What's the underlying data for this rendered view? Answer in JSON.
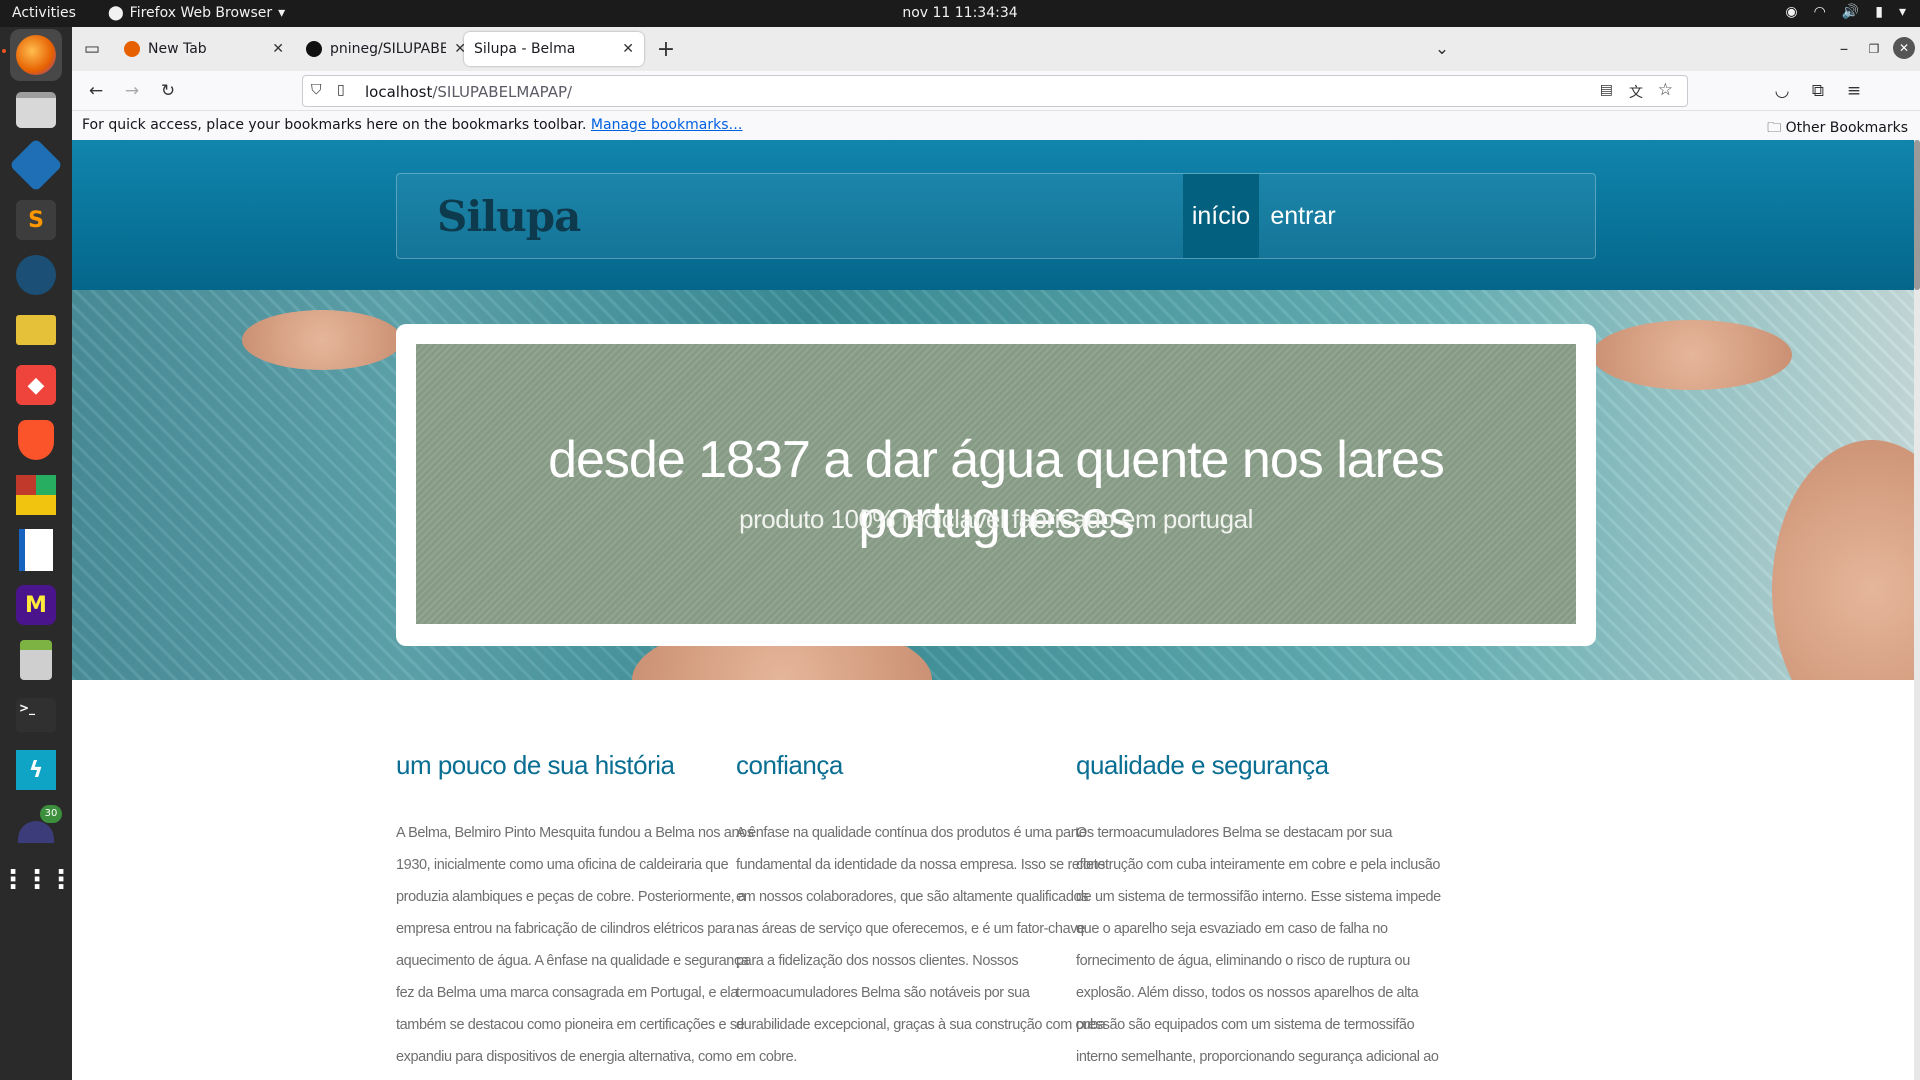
{
  "topbar": {
    "activities": "Activities",
    "app_name": "Firefox Web Browser",
    "clock": "nov 11  11:34:34"
  },
  "dock": {
    "items": [
      {
        "name": "firefox",
        "color": "#e66000"
      },
      {
        "name": "files",
        "color": "#b7b7b7"
      },
      {
        "name": "virtualbox",
        "color": "#1e6fb5"
      },
      {
        "name": "sublime-text",
        "color": "#ff9800"
      },
      {
        "name": "steam",
        "color": "#1b4f75"
      },
      {
        "name": "email-client",
        "color": "#2f3e2f"
      },
      {
        "name": "anydesk",
        "color": "#ef443b"
      },
      {
        "name": "brave",
        "color": "#fb542b"
      },
      {
        "name": "app-grid-colored",
        "color": "#c0392b"
      },
      {
        "name": "writer",
        "color": "#1565c0"
      },
      {
        "name": "meld",
        "color": "#4a148c"
      },
      {
        "name": "calculator",
        "color": "#cfcfcf"
      },
      {
        "name": "terminal",
        "color": "#303030"
      },
      {
        "name": "zeal",
        "color": "#0fa3c6"
      },
      {
        "name": "updates",
        "color": "#3c3c7a"
      },
      {
        "name": "show-apps",
        "color": "#2a2a2a"
      }
    ],
    "badge": "30"
  },
  "browser": {
    "tabs": [
      {
        "title": "New Tab",
        "favicon_color": "#e66000"
      },
      {
        "title": "pnineg/SILUPABELMAPAP",
        "favicon_color": "#111111"
      },
      {
        "title": "Silupa - Belma",
        "favicon_color": "#ffffff"
      }
    ],
    "url": {
      "host": "localhost",
      "path": "/SILUPABELMAPAP/"
    },
    "bookmarks": {
      "hint": "For quick access, place your bookmarks here on the bookmarks toolbar.",
      "manage_link": "Manage bookmarks…",
      "other": "Other Bookmarks"
    }
  },
  "site": {
    "logo": "Silupa",
    "nav": [
      "início",
      "entrar"
    ],
    "hero_title": "desde 1837 a dar água quente nos lares portugueses",
    "hero_subtitle": "produto 100% reciclavel fabricado em portugal",
    "columns": [
      {
        "title": "um pouco de sua história",
        "text": "A Belma, Belmiro Pinto Mesquita fundou a Belma nos anos 1930, inicialmente como uma oficina de caldeiraria que produzia alambiques e peças de cobre. Posteriormente, a empresa entrou na fabricação de cilindros elétricos para aquecimento de água. A ênfase na qualidade e segurança fez da Belma uma marca consagrada em Portugal, e ela também se destacou como pioneira em certificações e se expandiu para dispositivos de energia alternativa, como acumuladores para painéis solares."
      },
      {
        "title": "confiança",
        "text": "A ênfase na qualidade contínua dos produtos é uma parte fundamental da identidade da nossa empresa. Isso se reflete em nossos colaboradores, que são altamente qualificados nas áreas de serviço que oferecemos, e é um fator-chave para a fidelização dos nossos clientes. Nossos termoacumuladores Belma são notáveis por sua durabilidade excepcional, graças à sua construção com cuba em cobre."
      },
      {
        "title": "qualidade e segurança",
        "text": "Os termoacumuladores Belma se destacam por sua construção com cuba inteiramente em cobre e pela inclusão de um sistema de termossifão interno. Esse sistema impede que o aparelho seja esvaziado em caso de falha no fornecimento de água, eliminando o risco de ruptura ou explosão. Além disso, todos os nossos aparelhos de alta pressão são equipados com um sistema de termossifão interno semelhante, proporcionando segurança adicional ao manter a água no interior do aparelho em situações"
      }
    ]
  }
}
